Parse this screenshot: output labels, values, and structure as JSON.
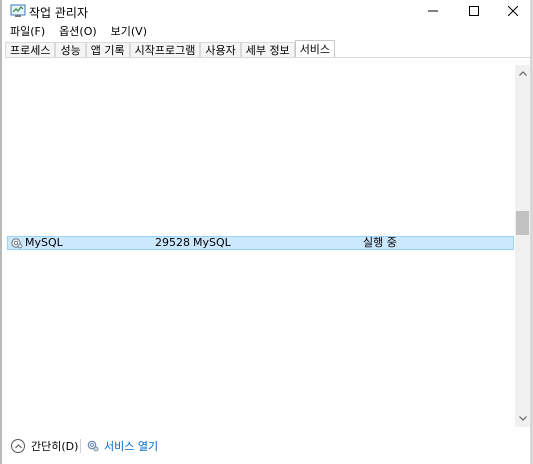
{
  "window": {
    "title": "작업 관리자",
    "icon": "task-manager-icon"
  },
  "menu": [
    "파일(F)",
    "옵션(O)",
    "보기(V)"
  ],
  "tabs": [
    {
      "label": "프로세스",
      "active": false
    },
    {
      "label": "성능",
      "active": false
    },
    {
      "label": "앱 기록",
      "active": false
    },
    {
      "label": "시작프로그램",
      "active": false
    },
    {
      "label": "사용자",
      "active": false
    },
    {
      "label": "세부 정보",
      "active": false
    },
    {
      "label": "서비스",
      "active": true
    }
  ],
  "services": [
    {
      "name": "MySQL",
      "pid": "29528",
      "description": "MySQL",
      "status": "실행 중",
      "selected": true
    }
  ],
  "bottom": {
    "fewer_details": "간단히(D)",
    "open_services": "서비스 열기"
  },
  "colors": {
    "selection_bg": "#cce8ff",
    "selection_border": "#99d1ff",
    "link": "#0066cc"
  }
}
